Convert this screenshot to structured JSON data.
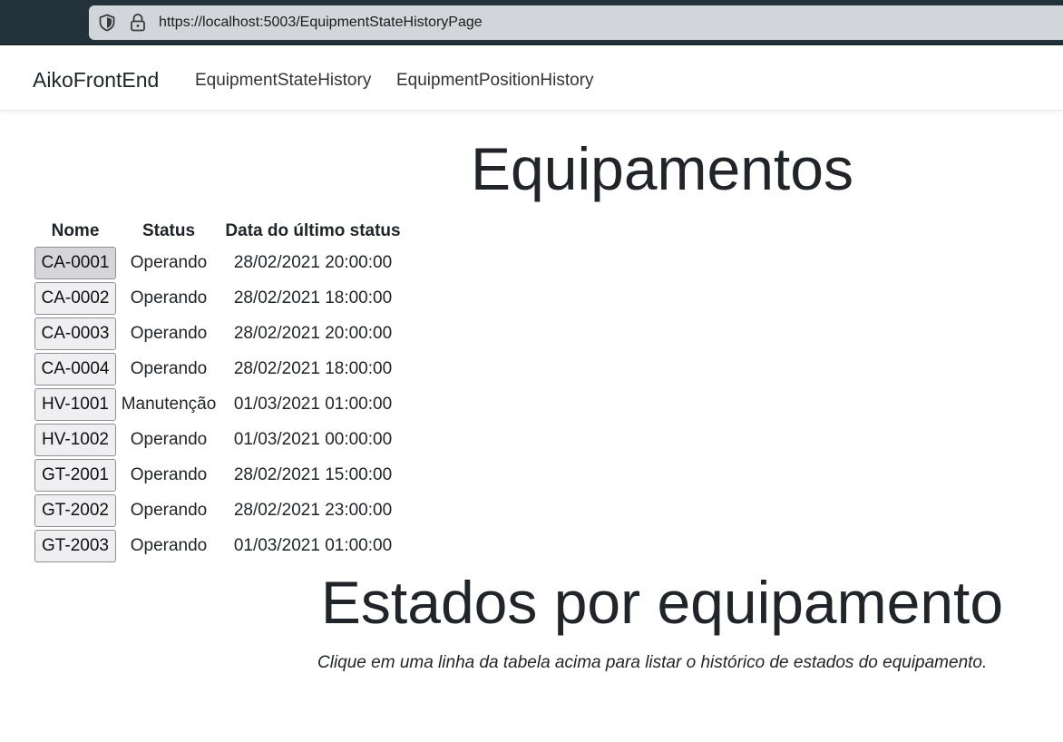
{
  "browser": {
    "url": "https://localhost:5003/EquipmentStateHistoryPage"
  },
  "navbar": {
    "brand": "AikoFrontEnd",
    "links": [
      "EquipmentStateHistory",
      "EquipmentPositionHistory"
    ]
  },
  "main": {
    "title": "Equipamentos",
    "table": {
      "headers": [
        "Nome",
        "Status",
        "Data do último status"
      ],
      "rows": [
        {
          "name": "CA-0001",
          "status": "Operando",
          "date": "28/02/2021 20:00:00"
        },
        {
          "name": "CA-0002",
          "status": "Operando",
          "date": "28/02/2021 18:00:00"
        },
        {
          "name": "CA-0003",
          "status": "Operando",
          "date": "28/02/2021 20:00:00"
        },
        {
          "name": "CA-0004",
          "status": "Operando",
          "date": "28/02/2021 18:00:00"
        },
        {
          "name": "HV-1001",
          "status": "Manutenção",
          "date": "01/03/2021 01:00:00"
        },
        {
          "name": "HV-1002",
          "status": "Operando",
          "date": "01/03/2021 00:00:00"
        },
        {
          "name": "GT-2001",
          "status": "Operando",
          "date": "28/02/2021 15:00:00"
        },
        {
          "name": "GT-2002",
          "status": "Operando",
          "date": "28/02/2021 23:00:00"
        },
        {
          "name": "GT-2003",
          "status": "Operando",
          "date": "01/03/2021 01:00:00"
        }
      ]
    },
    "states_title": "Estados por equipamento",
    "hint": "Clique em uma linha da tabela acima para listar o histórico de estados do equipamento."
  },
  "icons": {
    "shield": "shield-icon",
    "lock": "lock-icon"
  },
  "colors": {
    "chrome": "#23323a",
    "urlbar": "#d2d5d9",
    "button_bg": "#efeff1",
    "button_active_bg": "#d6d6da",
    "button_border": "#8e8e96"
  }
}
